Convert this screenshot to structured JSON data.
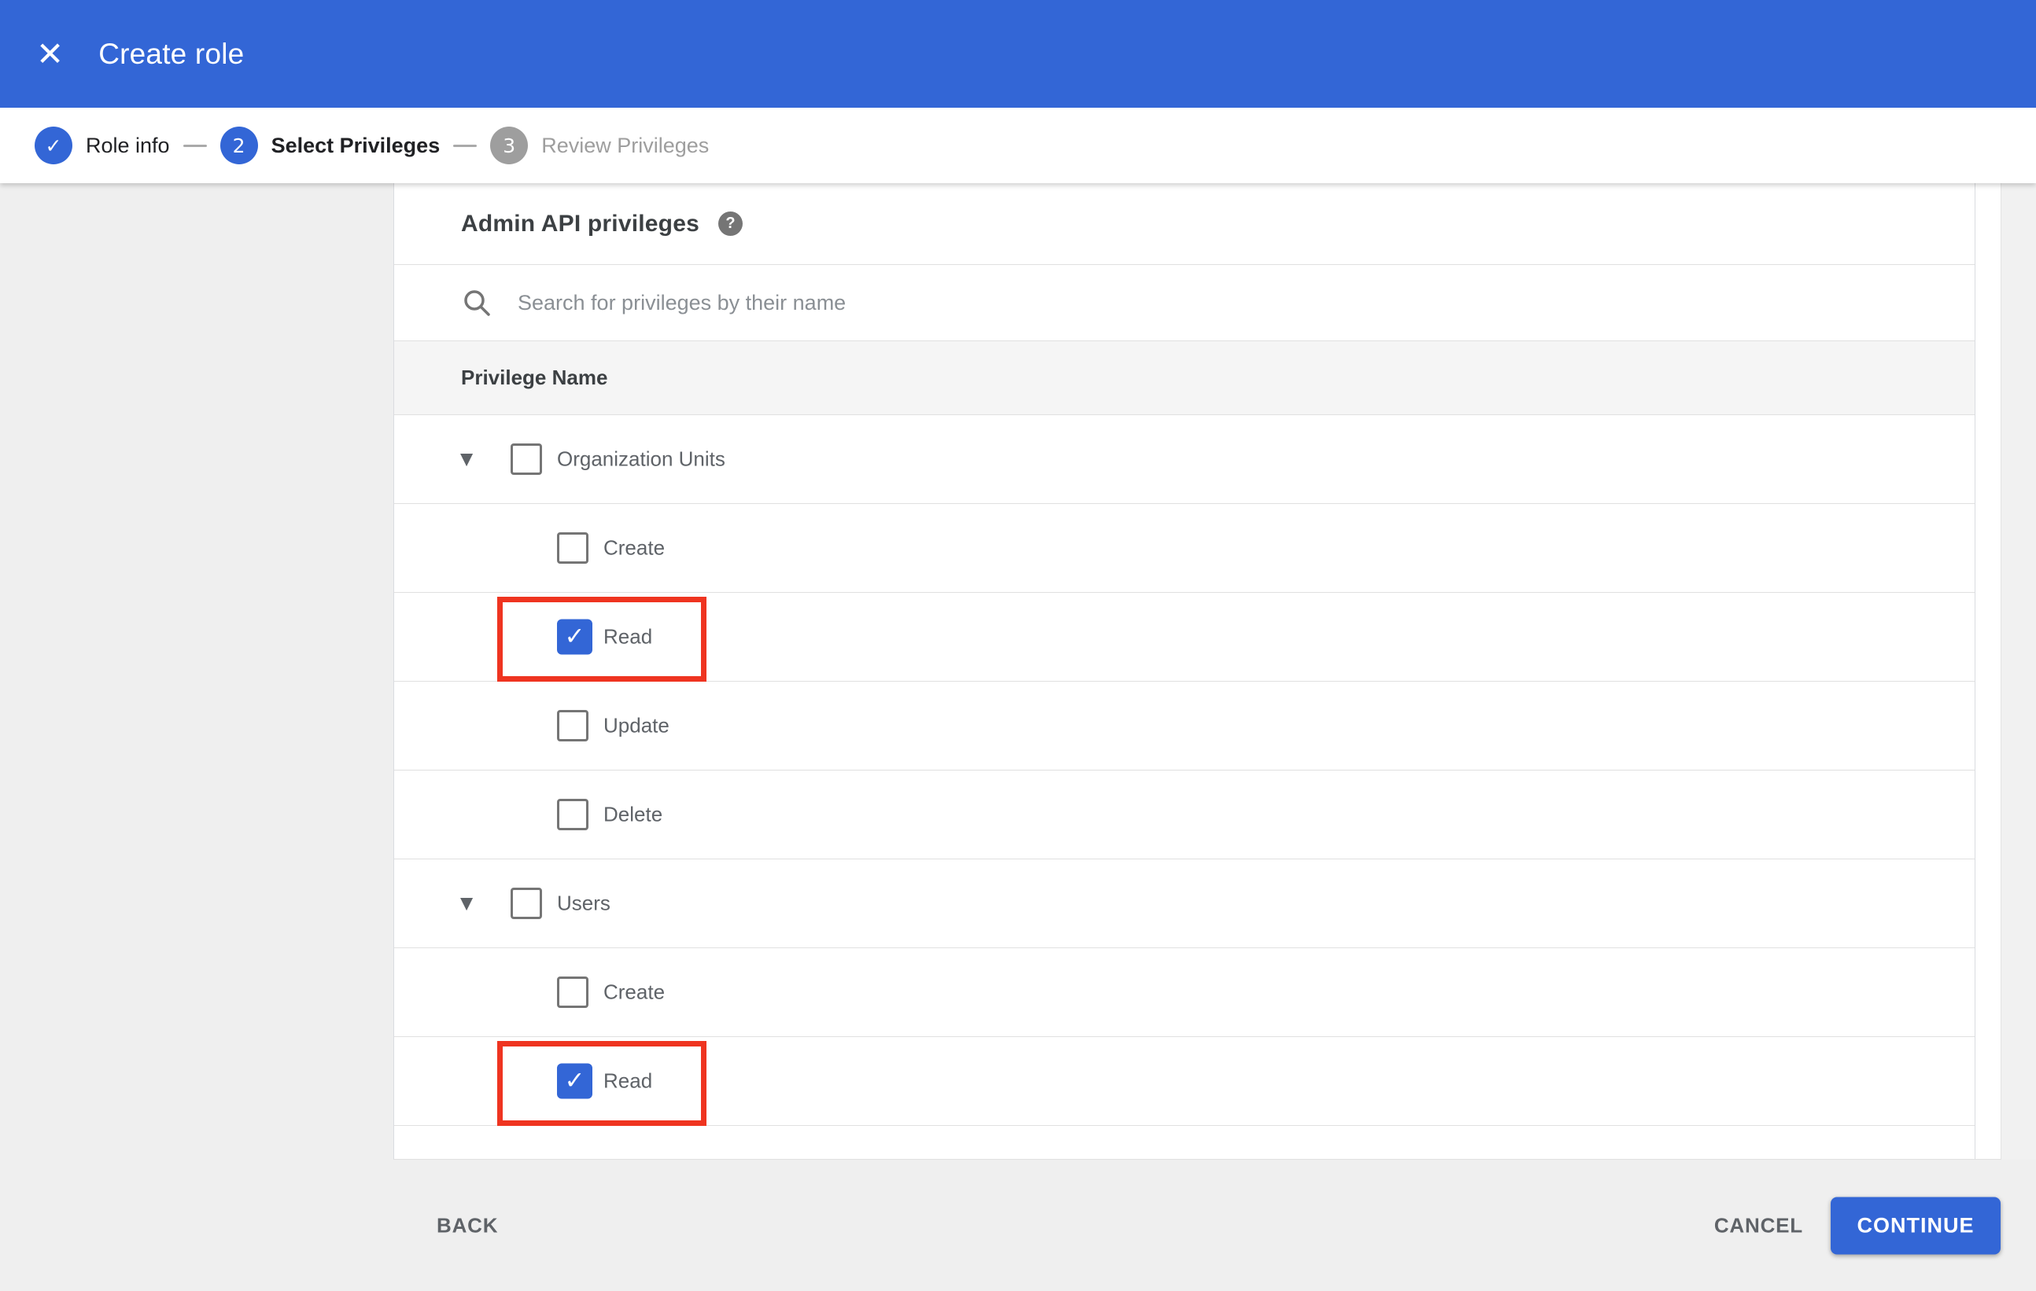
{
  "colors": {
    "accent": "#3366d6",
    "highlight": "#ef3420"
  },
  "appbar": {
    "title": "Create role",
    "close_glyph": "✕"
  },
  "stepper": {
    "steps": [
      {
        "number": "1",
        "label": "Role info",
        "state": "complete",
        "glyph": "✓"
      },
      {
        "number": "2",
        "label": "Select Privileges",
        "state": "active",
        "glyph": "2"
      },
      {
        "number": "3",
        "label": "Review Privileges",
        "state": "upcoming",
        "glyph": "3"
      }
    ]
  },
  "content": {
    "heading": "Admin API privileges",
    "help_glyph": "?",
    "search_placeholder": "Search for privileges by their name",
    "table": {
      "header": "Privilege Name",
      "caret_glyph": "▼",
      "check_glyph": "✓",
      "rows": [
        {
          "label": "Organization Units",
          "level": "parent",
          "expanded": true,
          "checked": false,
          "highlighted": false
        },
        {
          "label": "Create",
          "level": "child",
          "checked": false,
          "highlighted": false
        },
        {
          "label": "Read",
          "level": "child",
          "checked": true,
          "highlighted": true
        },
        {
          "label": "Update",
          "level": "child",
          "checked": false,
          "highlighted": false
        },
        {
          "label": "Delete",
          "level": "child",
          "checked": false,
          "highlighted": false
        },
        {
          "label": "Users",
          "level": "parent",
          "expanded": true,
          "checked": false,
          "highlighted": false
        },
        {
          "label": "Create",
          "level": "child",
          "checked": false,
          "highlighted": false
        },
        {
          "label": "Read",
          "level": "child",
          "checked": true,
          "highlighted": true
        }
      ]
    }
  },
  "footer": {
    "back": "BACK",
    "cancel": "CANCEL",
    "continue": "CONTINUE"
  }
}
